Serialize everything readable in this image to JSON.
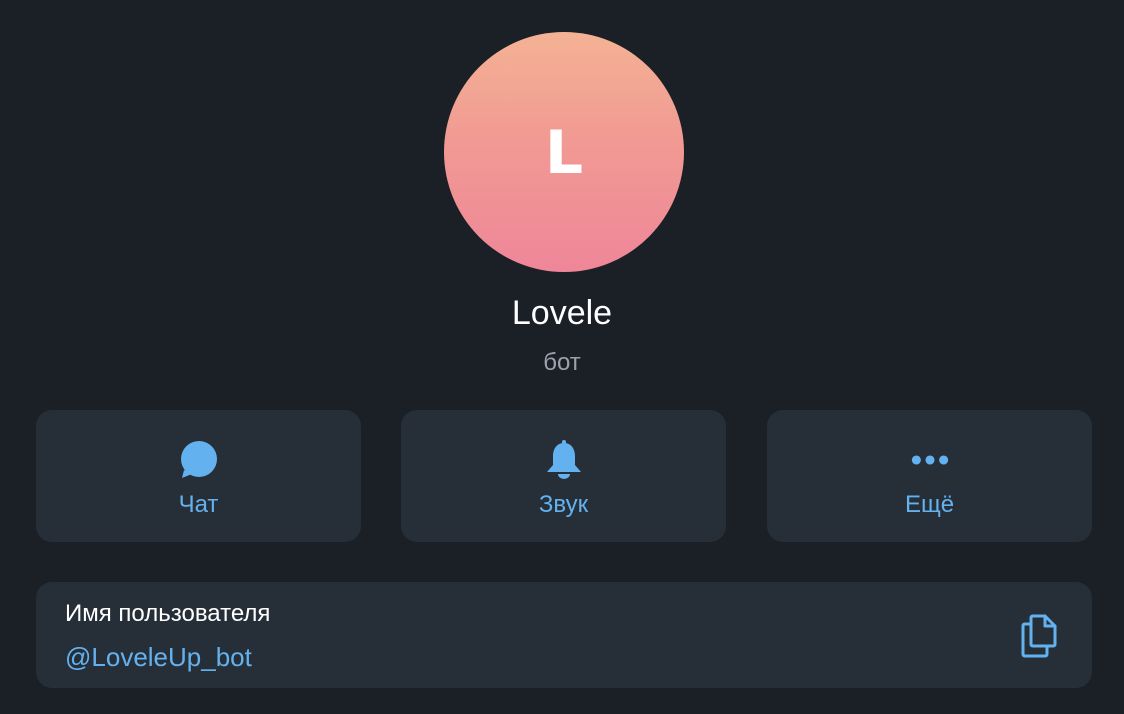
{
  "profile": {
    "avatar_letter": "L",
    "name": "Lovele",
    "subtitle": "бот"
  },
  "actions": [
    {
      "label": "Чат",
      "icon": "chat-bubble-icon"
    },
    {
      "label": "Звук",
      "icon": "bell-icon"
    },
    {
      "label": "Ещё",
      "icon": "more-dots-icon"
    }
  ],
  "info": {
    "label": "Имя пользователя",
    "value": "@LoveleUp_bot",
    "action_icon": "copy-icon"
  },
  "colors": {
    "background": "#1b1f26",
    "card": "#262f38",
    "accent": "#64b1ef",
    "avatar_gradient_top": "#f4b294",
    "avatar_gradient_bottom": "#ef8699",
    "subtitle": "#9aa3ad"
  }
}
